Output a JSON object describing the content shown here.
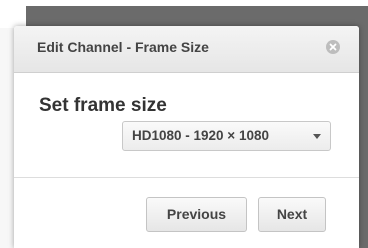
{
  "dialog": {
    "title": "Edit Channel - Frame Size",
    "close_icon": "close-icon"
  },
  "form": {
    "label": "Set frame size",
    "frame_size_select": {
      "selected": "HD1080 - 1920 × 1080"
    }
  },
  "footer": {
    "previous_label": "Previous",
    "next_label": "Next"
  }
}
